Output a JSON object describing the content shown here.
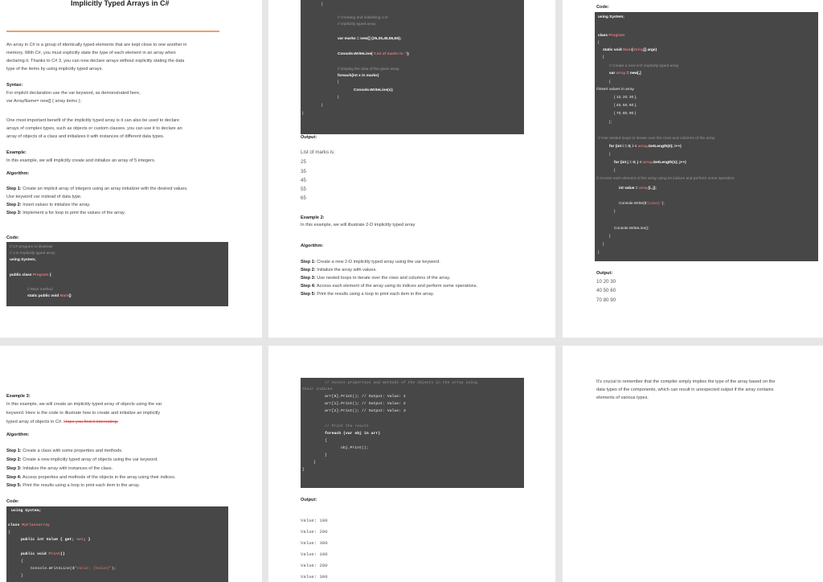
{
  "page1": {
    "title": "Implicitly Typed Arrays in C#",
    "intro": [
      "An array in C# is a group of identically typed elements that are kept close to one another in",
      "memory. With C#, you must explicitly state the type of each element in an array when",
      "declaring it. Thanks to C# 3,  you can now declare arrays without explicitly stating the data",
      "type of the items by using implicitly typed arrays."
    ],
    "syntax_label": "Syntax:",
    "syntax": [
      "For implicit declaration use the var keyword, as demonstrated here,",
      "var ArrayName= new[] { array items };"
    ],
    "benefit": [
      "One most important benefit of the implicitly typed array is it can also be used to declare",
      "arrays of complex types, such as objects or custom classes. you can use it to declare an",
      "array of objects of a class and initializes it with instances of different data types."
    ],
    "example_label": "Example:",
    "example": "In this example, we will implicitly create and initialize an array of 5 integers.",
    "algorithm_label": "Algorithm:",
    "steps": [
      {
        "label": "Step 1:",
        "text": "Create an implicit array of integers using an array initializer with the desired values."
      },
      {
        "label": "",
        "text": "Use keyword var instead of data type."
      },
      {
        "label": "Step 2:",
        "text": "Insert values to initialize the array."
      },
      {
        "label": "Step 3:",
        "text": "Implement a for loop to print the values of the array."
      }
    ],
    "code_label": "Code:",
    "code": [
      "// C# program to illustrate",
      "// 1-D implicitly typed array",
      "using System;",
      "",
      "public class Program {",
      "",
      "// Main method",
      "static public void Main()"
    ]
  },
  "page2": {
    "code": [
      "{",
      "// Creating and initializing 1-D",
      "// implicitly typed array",
      "var marks = new[] {25,35,45,55,65};",
      "Console.WriteLine(\"List of marks is: \");",
      "// Display the data of the given array",
      "foreach(int x in marks)",
      "{",
      "Console.WriteLine(x);",
      "}",
      "}",
      "}"
    ],
    "output_label": "Output:",
    "output": [
      "List of marks is:",
      "25",
      "35",
      "45",
      "55",
      "65"
    ],
    "example2_label": "Example 2:",
    "example2": "In this example, we will illustrate 2-D implicitly typed array",
    "algorithm_label": "Algorithm:",
    "steps": [
      {
        "label": "Step 1:",
        "text": "Create a new 2-D implicitly typed array using the var keyword."
      },
      {
        "label": "Step 2:",
        "text": "Initialize the array with values."
      },
      {
        "label": "Step 3:",
        "text": "Use nested loops to iterate over the rows and columns of the array."
      },
      {
        "label": "Step 4:",
        "text": "Access each element of the array using its indices and perform some operations."
      },
      {
        "label": "Step 5:",
        "text": "Print the results using a loop to print each item in the array."
      }
    ]
  },
  "page3": {
    "code_label": "Code:",
    "code": [
      "using System;",
      "",
      "class Program",
      "{",
      "static void Main(string[] args)",
      "{",
      "// Create a new 2-D implicitly typed array",
      "var array = new[,]",
      "{",
      "//insert values in array",
      "{ 10, 20, 30 },",
      "{ 40, 50, 60 },",
      "{ 70, 80, 90 }",
      "};",
      "",
      "// Use nested loops to iterate over the rows and columns of the array",
      "for (int i = 0; i < array.GetLength(0); i++)",
      "{",
      "for (int j = 0; j < array.GetLength(1); j++)",
      "{",
      "// Access each element of the array using its indices and perform some operation",
      "int value = array[i, j];",
      "",
      "Console.Write($\"{value} \");",
      "}",
      "",
      "Console.WriteLine();",
      "}",
      "}",
      "}"
    ],
    "output_label": "Output:",
    "output": [
      "10 20 30",
      "40 50 60",
      "70 80 90"
    ]
  },
  "page4": {
    "example3_label": "Example 3:",
    "example3": [
      "In this example, we will create an implicitly typed array of objects using the var",
      "keyword. Here is the code to illustrate how to create and initialize an implicitly",
      "typed array of objects in C#."
    ],
    "strike": "Hope you find it interesting.",
    "algorithm_label": "Algorithm:",
    "steps": [
      {
        "label": "Step 1:",
        "text": "Create a class with some properties and methods."
      },
      {
        "label": "Step 2:",
        "text": "Create a new implicitly typed array of objects using the var keyword."
      },
      {
        "label": "Step 3:",
        "text": "Initialize the array with instances of the class."
      },
      {
        "label": "Step 4:",
        "text": "Access properties and methods of the objects in the array using their indices."
      },
      {
        "label": "Step 5:",
        "text": "Print the results using a loop to print each item in the array."
      }
    ],
    "code_label": "Code:",
    "code": [
      "using System;",
      "",
      "class MyClassarray",
      "{",
      "public int Value { get; set; }",
      "",
      "public void Print()",
      "{",
      "Console.WriteLine($\"Value: {Value}\");",
      "}"
    ]
  },
  "page5": {
    "code": [
      "// Access properties and methods of the objects in the array using",
      "their indices",
      "arr[0].Print(); // Output: Value: 1",
      "arr[1].Print(); // Output: Value: 2",
      "arr[2].Print(); // Output: Value: 3",
      "",
      "// Print the result",
      "foreach (var obj in arr)",
      "{",
      "obj.Print();",
      "}",
      "}",
      "}"
    ],
    "output_label": "Output:",
    "output": [
      "Value: 100",
      "Value: 200",
      "Value: 300",
      "Value: 100",
      "Value: 200",
      "Value: 300"
    ]
  },
  "page6": {
    "text": [
      "It's crucial to remember that the compiler simply implies the type of the array based on the",
      "data types of the components, which can result in unexpected output if the array contains",
      "elements of various types."
    ]
  }
}
